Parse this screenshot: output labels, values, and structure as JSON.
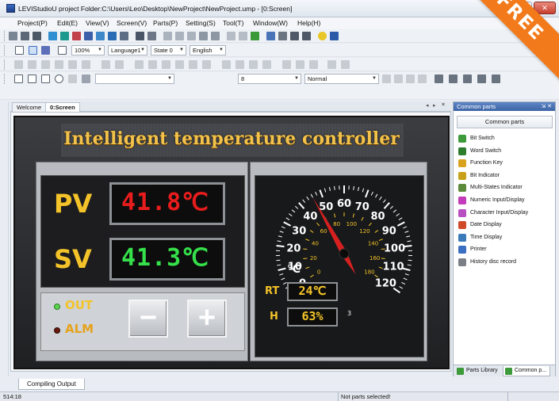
{
  "window": {
    "title": "LEVIStudioU  project Folder:C:\\Users\\Leo\\Desktop\\NewProject\\NewProject.ump  - [0:Screen]",
    "minimize": "–",
    "maximize": "□",
    "close": "✕"
  },
  "ribbon": {
    "text": "FREE",
    "color": "#f27a1a"
  },
  "menu": [
    "Project(P)",
    "Edit(E)",
    "View(V)",
    "Screen(V)",
    "Parts(P)",
    "Setting(S)",
    "Tool(T)",
    "Window(W)",
    "Help(H)"
  ],
  "toolbar3": {
    "zoom": "100%",
    "language": "Language1",
    "state": "State 0",
    "display_language": "English"
  },
  "toolbar5": {
    "font_size": "8",
    "style": "Normal"
  },
  "tabs": {
    "welcome": "Welcome",
    "screen": "0:Screen",
    "close": "×"
  },
  "hmi": {
    "title": "Intelligent temperature controller",
    "pv_label": "PV",
    "pv_value": "41.8℃",
    "sv_label": "SV",
    "sv_value": "41.3℃",
    "out_label": "OUT",
    "alm_label": "ALM",
    "minus": "−",
    "plus": "+",
    "rt_label": "RT",
    "rt_value": "24℃",
    "h_label": "H",
    "h_value": "63%",
    "gauge": {
      "outer_ticks": [
        "0",
        "10",
        "20",
        "30",
        "40",
        "50",
        "60",
        "70",
        "80",
        "90",
        "100",
        "110",
        "120"
      ],
      "inner_ticks": [
        "0",
        "20",
        "40",
        "60",
        "80",
        "100",
        "120",
        "140",
        "160",
        "180"
      ],
      "unit": "℃",
      "needle_value": 46,
      "small_label": "3",
      "colors": {
        "needle": "#d62020",
        "text": "#ffffff",
        "inner": "#f3c329"
      }
    },
    "colors": {
      "pv": "#e81c1c",
      "sv": "#35e04a",
      "gold": "#f3c329",
      "out_led": "#58d34c",
      "alm_led": "#6a1a0e"
    }
  },
  "pane": {
    "header": "Common parts",
    "pin": "⇲ ✕",
    "title": "Common parts",
    "items": [
      {
        "label": "Bit Switch",
        "icon": "bit-switch-icon",
        "color": "#3d9a3a"
      },
      {
        "label": "Word Switch",
        "icon": "word-switch-icon",
        "color": "#2e7d2e"
      },
      {
        "label": "Function Key",
        "icon": "function-key-icon",
        "color": "#d9a21e"
      },
      {
        "label": "Bit Indicator",
        "icon": "bit-indicator-icon",
        "color": "#c8a01a"
      },
      {
        "label": "Multi-States Indicator",
        "icon": "multi-states-icon",
        "color": "#5a8a3a"
      },
      {
        "label": "Numeric Input/Display",
        "icon": "numeric-icon",
        "color": "#c23bb8"
      },
      {
        "label": "Character Input/Display",
        "icon": "character-icon",
        "color": "#b84fc0"
      },
      {
        "label": "Date Display",
        "icon": "date-icon",
        "color": "#d04a2a"
      },
      {
        "label": "Time Display",
        "icon": "time-icon",
        "color": "#3a7ab8"
      },
      {
        "label": "Printer",
        "icon": "printer-icon",
        "color": "#3a6fc2"
      },
      {
        "label": "History disc record",
        "icon": "history-icon",
        "color": "#7a7f86"
      }
    ],
    "tab_library": "Parts Library",
    "tab_common": "Common p..."
  },
  "output_tab": "Compiling Output",
  "status": {
    "coords": "514:18",
    "message": "Not parts selected!"
  }
}
